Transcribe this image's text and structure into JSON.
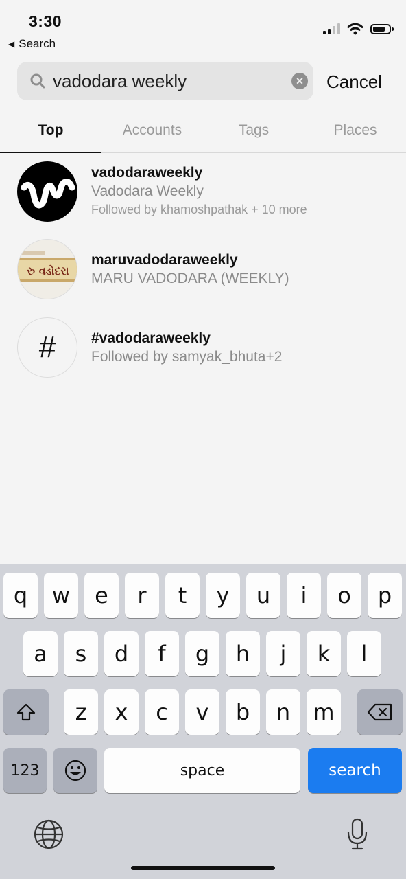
{
  "status": {
    "time": "3:30",
    "back": "Search"
  },
  "search": {
    "query": "vadodara weekly",
    "cancel": "Cancel"
  },
  "tabs": [
    "Top",
    "Accounts",
    "Tags",
    "Places"
  ],
  "results": [
    {
      "title": "vadodaraweekly",
      "subtitle": "Vadodara Weekly",
      "meta": "Followed by khamoshpathak + 10 more"
    },
    {
      "title": "maruvadodaraweekly",
      "subtitle": "MARU VADODARA (WEEKLY)",
      "logo_text": "રુ વડોદરા"
    },
    {
      "title": "#vadodaraweekly",
      "subtitle": "Followed by samyak_bhuta+2",
      "avatar_glyph": "#"
    }
  ],
  "keyboard": {
    "row1": [
      "q",
      "w",
      "e",
      "r",
      "t",
      "y",
      "u",
      "i",
      "o",
      "p"
    ],
    "row2": [
      "a",
      "s",
      "d",
      "f",
      "g",
      "h",
      "j",
      "k",
      "l"
    ],
    "row3": [
      "z",
      "x",
      "c",
      "v",
      "b",
      "n",
      "m"
    ],
    "numbers": "123",
    "space": "space",
    "search": "search"
  },
  "icons": {
    "status": [
      "signal-icon",
      "wifi-icon",
      "battery-icon"
    ],
    "search": "search-icon",
    "clear": "clear-icon",
    "keyboard": [
      "shift-icon",
      "delete-icon",
      "emoji-icon",
      "globe-icon",
      "microphone-icon"
    ]
  },
  "colors": {
    "accent": "#1b7cf0",
    "keyboard_bg": "#d1d3d9",
    "muted_text": "#8a8a8a"
  }
}
